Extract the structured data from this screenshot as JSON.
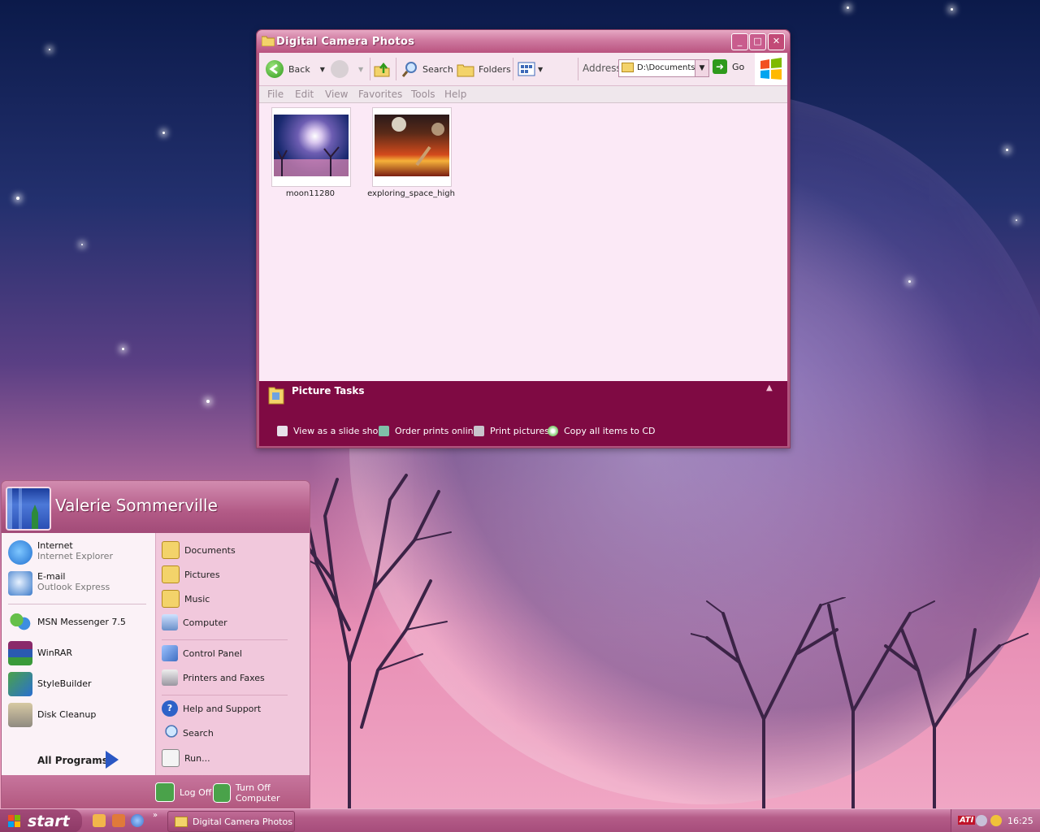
{
  "explorer": {
    "title": "Digital Camera Photos",
    "toolbar": {
      "back": "Back",
      "search": "Search",
      "folders": "Folders",
      "address_label": "Address",
      "address_value": "D:\\Documents a",
      "go": "Go"
    },
    "menu": [
      "File",
      "Edit",
      "View",
      "Favorites",
      "Tools",
      "Help"
    ],
    "files": [
      {
        "name": "moon11280"
      },
      {
        "name": "exploring_space_high"
      }
    ],
    "tasks": {
      "header": "Picture Tasks",
      "items": [
        "View as a slide show",
        "Order prints online",
        "Print pictures",
        "Copy all items to CD"
      ]
    }
  },
  "startmenu": {
    "user": "Valerie Sommerville",
    "pinned": [
      {
        "title": "Internet",
        "subtitle": "Internet Explorer",
        "icon": "internet-explorer-icon"
      },
      {
        "title": "E-mail",
        "subtitle": "Outlook Express",
        "icon": "outlook-express-icon"
      }
    ],
    "recent": [
      {
        "title": "MSN Messenger 7.5",
        "icon": "msn-messenger-icon"
      },
      {
        "title": "WinRAR",
        "icon": "winrar-icon"
      },
      {
        "title": "StyleBuilder",
        "icon": "stylebuilder-icon"
      },
      {
        "title": "Disk Cleanup",
        "icon": "disk-cleanup-icon"
      }
    ],
    "all_programs": "All Programs",
    "places": [
      {
        "label": "Documents",
        "icon": "documents-folder-icon"
      },
      {
        "label": "Pictures",
        "icon": "pictures-folder-icon"
      },
      {
        "label": "Music",
        "icon": "music-folder-icon"
      },
      {
        "label": "Computer",
        "icon": "computer-icon"
      }
    ],
    "system": [
      {
        "label": "Control Panel",
        "icon": "control-panel-icon"
      },
      {
        "label": "Printers and Faxes",
        "icon": "printer-icon"
      }
    ],
    "help": [
      {
        "label": "Help and Support",
        "icon": "help-icon"
      },
      {
        "label": "Search",
        "icon": "search-icon"
      },
      {
        "label": "Run...",
        "icon": "run-icon"
      }
    ],
    "footer": {
      "log_off": "Log Off",
      "turn_off": "Turn Off Computer"
    }
  },
  "taskbar": {
    "start": "start",
    "task_button": "Digital Camera Photos",
    "quicklaunch_more": "»",
    "clock": "16:25"
  },
  "colors": {
    "title_gradient": "#cf7aa0",
    "task_pane": "#7f0a43",
    "taskbar": "#b45c88",
    "start_button": "#8d3966"
  }
}
